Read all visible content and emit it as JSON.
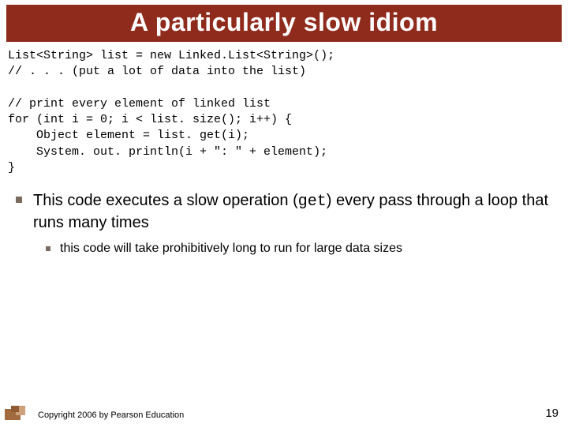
{
  "title": "A particularly slow idiom",
  "code_lines": [
    "List<String> list = new Linked.List<String>();",
    "// . . . (put a lot of data into the list)",
    "",
    "// print every element of linked list",
    "for (int i = 0; i < list. size(); i++) {",
    "    Object element = list. get(i);",
    "    System. out. println(i + \": \" + element);",
    "}"
  ],
  "bullet": {
    "pre": "This code executes a slow operation (",
    "mono": "get",
    "post": ") every pass through a loop that runs many times"
  },
  "sub_bullet": "this code will take prohibitively long to run for large data sizes",
  "copyright": "Copyright 2006 by Pearson Education",
  "page": "19"
}
